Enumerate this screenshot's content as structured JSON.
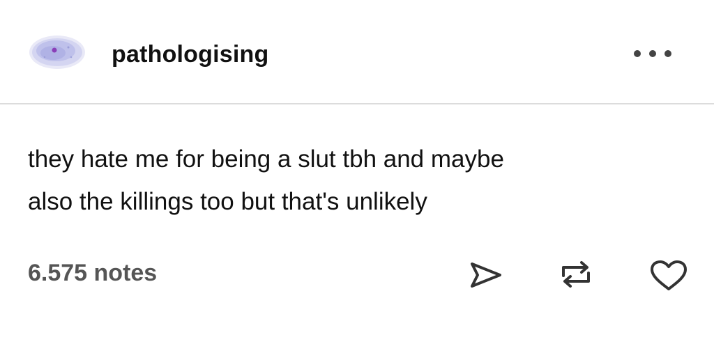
{
  "post": {
    "username": "pathologising",
    "body_lines": [
      "they hate me for being a slut tbh and maybe",
      "also the killings too but that's unlikely"
    ],
    "notes_label": "6.575 notes"
  },
  "icons": {
    "avatar": "avatar-image",
    "more": "ellipsis-icon",
    "share": "share-arrow-icon",
    "reblog": "reblog-icon",
    "like": "heart-icon"
  },
  "colors": {
    "background": "#ffffff",
    "text": "#111111",
    "notes": "#555555",
    "divider": "#dcdcdc",
    "icon": "#333333",
    "avatar_tint": "#8d8fdc"
  }
}
